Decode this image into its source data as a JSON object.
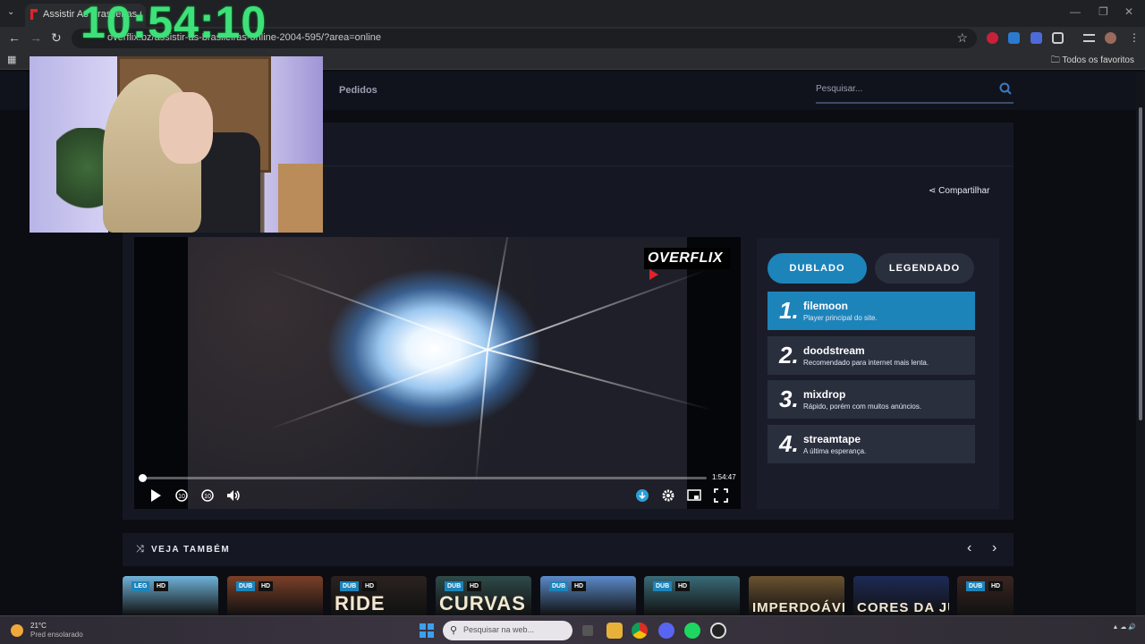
{
  "browser": {
    "tab_title": "Assistir As Brasileiras Online G...",
    "url": "overflix.bz/assistir-as-brasileiras-online-2004-595/?area=online",
    "bookmarks_folder": "Todos os favoritos"
  },
  "overlay": {
    "clock": "10:54:10"
  },
  "site": {
    "nav_item": "Pedidos",
    "search_placeholder": "Pesquisar...",
    "share_label": "Compartilhar",
    "player": {
      "logo_text": "OVERFLIX",
      "duration": "1:54:47",
      "progress": 0.0
    },
    "language_tabs": {
      "dubbed": "DUBLADO",
      "subtitled": "LEGENDADO"
    },
    "servers": [
      {
        "num": "1.",
        "name": "filemoon",
        "desc": "Player principal do site."
      },
      {
        "num": "2.",
        "name": "doodstream",
        "desc": "Recomendado para internet mais lenta."
      },
      {
        "num": "3.",
        "name": "mixdrop",
        "desc": "Rápido, porém com muitos anúncios."
      },
      {
        "num": "4.",
        "name": "streamtape",
        "desc": "A última esperança."
      }
    ],
    "related_title": "VEJA TAMBÉM",
    "cards": [
      {
        "b1": "LEG",
        "b2": "HD",
        "title": "",
        "color": "#6fb3d9"
      },
      {
        "b1": "DUB",
        "b2": "HD",
        "title": "",
        "color": "#7a4028"
      },
      {
        "b1": "DUB",
        "b2": "HD",
        "title": "RIDE",
        "color": "#2a2220"
      },
      {
        "b1": "DUB",
        "b2": "HD",
        "title": "CURVAS",
        "color": "#2f4a4a"
      },
      {
        "b1": "DUB",
        "b2": "HD",
        "title": "",
        "color": "#5b8ac9"
      },
      {
        "b1": "DUB",
        "b2": "HD",
        "title": "",
        "color": "#3a6b78"
      },
      {
        "b1": "",
        "b2": "",
        "title": "IMPERDOÁVEL",
        "color": "#6b5330"
      },
      {
        "b1": "",
        "b2": "",
        "title": "CORES DA JUSTIÇA",
        "color": "#1d2a55"
      },
      {
        "b1": "DUB",
        "b2": "HD",
        "title": "",
        "color": "#3a2520"
      }
    ]
  },
  "taskbar": {
    "weather_temp": "21°C",
    "weather_desc": "Pred ensolarado",
    "search_placeholder": "Pesquisar na web..."
  }
}
